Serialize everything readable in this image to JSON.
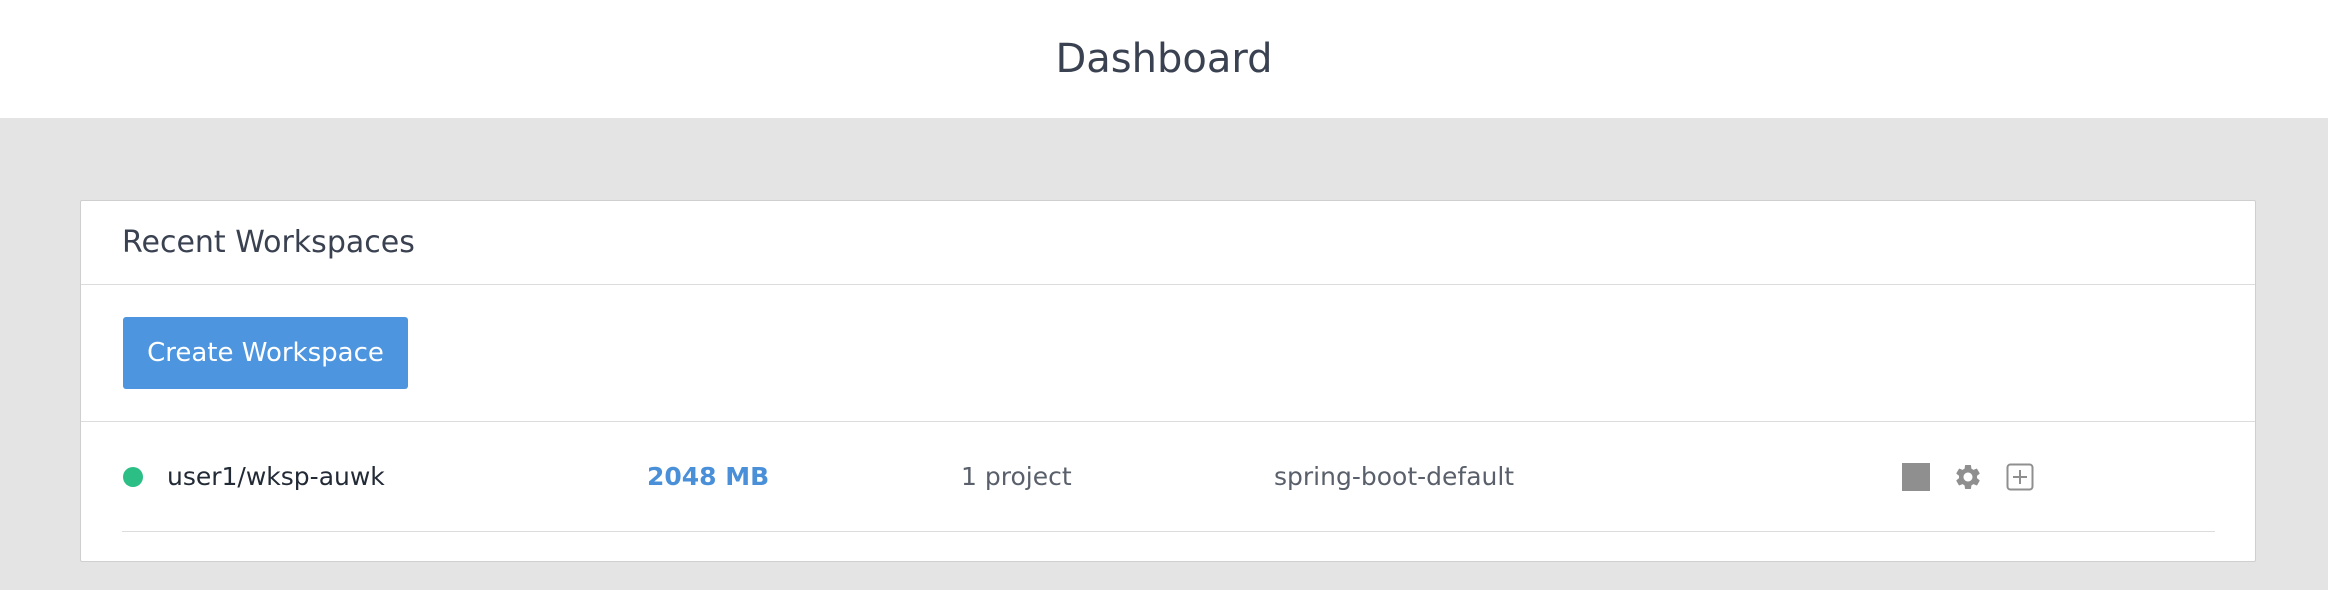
{
  "header": {
    "title": "Dashboard"
  },
  "recent": {
    "title": "Recent Workspaces",
    "create_button": "Create Workspace",
    "workspaces": [
      {
        "status_color": "#2bbf86",
        "name": "user1/wksp-auwk",
        "memory": "2048 MB",
        "projects": "1 project",
        "stack": "spring-boot-default",
        "actions": [
          "stop-icon",
          "gear-icon",
          "add-icon"
        ]
      }
    ]
  },
  "colors": {
    "accent": "#4e95e0",
    "running": "#2bbf86",
    "icon": "#8f8f8f"
  }
}
